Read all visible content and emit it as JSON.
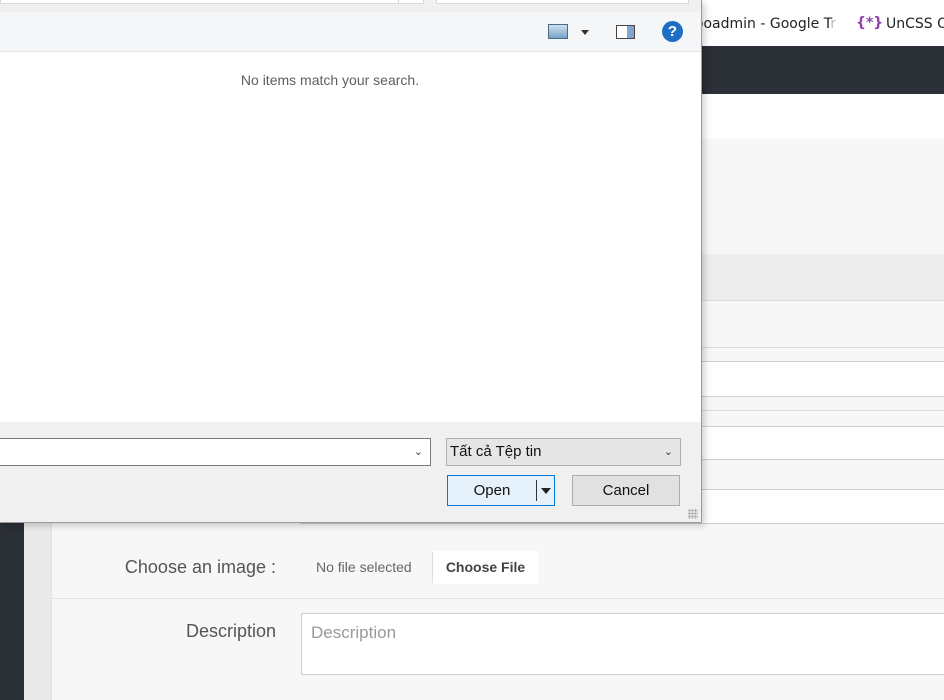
{
  "bookmarks": {
    "google_label": "fooadmin - Google T",
    "google_fade": "r",
    "uncss_icon": "{*}",
    "uncss_label": "UnCSS O"
  },
  "form": {
    "image_label": "Choose an image :",
    "file_status": "No file selected",
    "choose_file_label": "Choose File",
    "description_label": "Description",
    "description_placeholder": "Description"
  },
  "dialog": {
    "toolbar": {
      "view_icon": "change-view-icon",
      "pane_icon": "preview-pane-icon",
      "help_label": "?"
    },
    "empty_message": "No items match your search.",
    "filename_value": "",
    "filetype_selected": "Tất cả Tệp tin",
    "open_label": "Open",
    "cancel_label": "Cancel"
  },
  "colors": {
    "accent": "#0078d7",
    "help": "#1e6fc3",
    "nav_dark": "#2b2f36"
  }
}
